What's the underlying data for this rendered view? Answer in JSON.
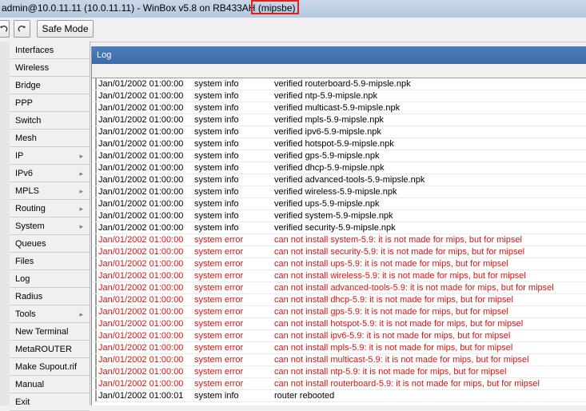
{
  "window": {
    "title": "admin@10.0.11.11 (10.0.11.11) - WinBox v5.8 on RB433AH",
    "title_highlight": "(mipsbe)"
  },
  "toolbar": {
    "safe_mode_label": "Safe Mode"
  },
  "sidebar": {
    "items": [
      {
        "label": "Interfaces",
        "submenu": false
      },
      {
        "label": "Wireless",
        "submenu": false
      },
      {
        "label": "Bridge",
        "submenu": false
      },
      {
        "label": "PPP",
        "submenu": false
      },
      {
        "label": "Switch",
        "submenu": false
      },
      {
        "label": "Mesh",
        "submenu": false
      },
      {
        "label": "IP",
        "submenu": true
      },
      {
        "label": "IPv6",
        "submenu": true
      },
      {
        "label": "MPLS",
        "submenu": true
      },
      {
        "label": "Routing",
        "submenu": true
      },
      {
        "label": "System",
        "submenu": true
      },
      {
        "label": "Queues",
        "submenu": false
      },
      {
        "label": "Files",
        "submenu": false
      },
      {
        "label": "Log",
        "submenu": false
      },
      {
        "label": "Radius",
        "submenu": false
      },
      {
        "label": "Tools",
        "submenu": true
      },
      {
        "label": "New Terminal",
        "submenu": false
      },
      {
        "label": "MetaROUTER",
        "submenu": false
      },
      {
        "label": "Make Supout.rif",
        "submenu": false
      },
      {
        "label": "Manual",
        "submenu": false
      },
      {
        "label": "Exit",
        "submenu": false
      }
    ]
  },
  "log": {
    "title": "Log",
    "colors": {
      "info": "#000000",
      "error": "#d9130f"
    },
    "rows": [
      {
        "time": "Jan/01/2002 01:00:00",
        "topics": "system info",
        "message": "verified routerboard-5.9-mipsle.npk",
        "level": "info"
      },
      {
        "time": "Jan/01/2002 01:00:00",
        "topics": "system info",
        "message": "verified ntp-5.9-mipsle.npk",
        "level": "info"
      },
      {
        "time": "Jan/01/2002 01:00:00",
        "topics": "system info",
        "message": "verified multicast-5.9-mipsle.npk",
        "level": "info"
      },
      {
        "time": "Jan/01/2002 01:00:00",
        "topics": "system info",
        "message": "verified mpls-5.9-mipsle.npk",
        "level": "info"
      },
      {
        "time": "Jan/01/2002 01:00:00",
        "topics": "system info",
        "message": "verified ipv6-5.9-mipsle.npk",
        "level": "info"
      },
      {
        "time": "Jan/01/2002 01:00:00",
        "topics": "system info",
        "message": "verified hotspot-5.9-mipsle.npk",
        "level": "info"
      },
      {
        "time": "Jan/01/2002 01:00:00",
        "topics": "system info",
        "message": "verified gps-5.9-mipsle.npk",
        "level": "info"
      },
      {
        "time": "Jan/01/2002 01:00:00",
        "topics": "system info",
        "message": "verified dhcp-5.9-mipsle.npk",
        "level": "info"
      },
      {
        "time": "Jan/01/2002 01:00:00",
        "topics": "system info",
        "message": "verified advanced-tools-5.9-mipsle.npk",
        "level": "info"
      },
      {
        "time": "Jan/01/2002 01:00:00",
        "topics": "system info",
        "message": "verified wireless-5.9-mipsle.npk",
        "level": "info"
      },
      {
        "time": "Jan/01/2002 01:00:00",
        "topics": "system info",
        "message": "verified ups-5.9-mipsle.npk",
        "level": "info"
      },
      {
        "time": "Jan/01/2002 01:00:00",
        "topics": "system info",
        "message": "verified system-5.9-mipsle.npk",
        "level": "info"
      },
      {
        "time": "Jan/01/2002 01:00:00",
        "topics": "system info",
        "message": "verified security-5.9-mipsle.npk",
        "level": "info"
      },
      {
        "time": "Jan/01/2002 01:00:00",
        "topics": "system error",
        "message": "can not install system-5.9: it is not made for mips, but for mipsel",
        "level": "error"
      },
      {
        "time": "Jan/01/2002 01:00:00",
        "topics": "system error",
        "message": "can not install security-5.9: it is not made for mips, but for mipsel",
        "level": "error"
      },
      {
        "time": "Jan/01/2002 01:00:00",
        "topics": "system error",
        "message": "can not install ups-5.9: it is not made for mips, but for mipsel",
        "level": "error"
      },
      {
        "time": "Jan/01/2002 01:00:00",
        "topics": "system error",
        "message": "can not install wireless-5.9: it is not made for mips, but for mipsel",
        "level": "error"
      },
      {
        "time": "Jan/01/2002 01:00:00",
        "topics": "system error",
        "message": "can not install advanced-tools-5.9: it is not made for mips, but for mipsel",
        "level": "error"
      },
      {
        "time": "Jan/01/2002 01:00:00",
        "topics": "system error",
        "message": "can not install dhcp-5.9: it is not made for mips, but for mipsel",
        "level": "error"
      },
      {
        "time": "Jan/01/2002 01:00:00",
        "topics": "system error",
        "message": "can not install gps-5.9: it is not made for mips, but for mipsel",
        "level": "error"
      },
      {
        "time": "Jan/01/2002 01:00:00",
        "topics": "system error",
        "message": "can not install hotspot-5.9: it is not made for mips, but for mipsel",
        "level": "error"
      },
      {
        "time": "Jan/01/2002 01:00:00",
        "topics": "system error",
        "message": "can not install ipv6-5.9: it is not made for mips, but for mipsel",
        "level": "error"
      },
      {
        "time": "Jan/01/2002 01:00:00",
        "topics": "system error",
        "message": "can not install mpls-5.9: it is not made for mips, but for mipsel",
        "level": "error"
      },
      {
        "time": "Jan/01/2002 01:00:00",
        "topics": "system error",
        "message": "can not install multicast-5.9: it is not made for mips, but for mipsel",
        "level": "error"
      },
      {
        "time": "Jan/01/2002 01:00:00",
        "topics": "system error",
        "message": "can not install ntp-5.9: it is not made for mips, but for mipsel",
        "level": "error"
      },
      {
        "time": "Jan/01/2002 01:00:00",
        "topics": "system error",
        "message": "can not install routerboard-5.9: it is not made for mips, but for mipsel",
        "level": "error"
      },
      {
        "time": "Jan/01/2002 01:00:01",
        "topics": "system info",
        "message": "router rebooted",
        "level": "info"
      }
    ]
  }
}
